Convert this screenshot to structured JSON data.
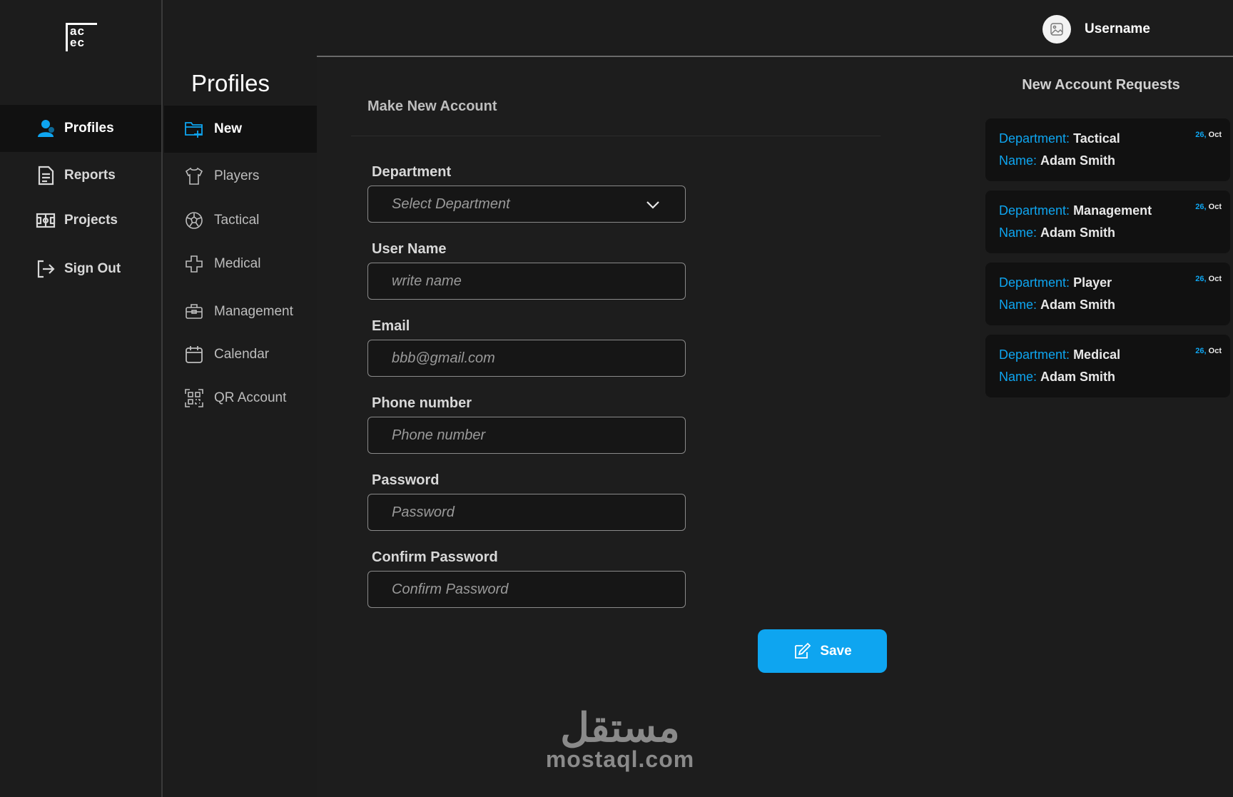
{
  "colors": {
    "accent": "#0ea5f0",
    "background": "#1b1b1b",
    "panel": "#111111"
  },
  "logo": {
    "line1": "ac",
    "line2": "ec"
  },
  "sidebar": {
    "items": [
      {
        "label": "Profiles",
        "icon": "user-icon"
      },
      {
        "label": "Reports",
        "icon": "document-icon"
      },
      {
        "label": "Projects",
        "icon": "field-icon"
      },
      {
        "label": "Sign Out",
        "icon": "sign-out-icon"
      }
    ]
  },
  "header": {
    "username": "Username",
    "avatar_icon": "image-icon"
  },
  "submenu": {
    "title": "Profiles",
    "items": [
      {
        "label": "New",
        "icon": "folder-plus-icon"
      },
      {
        "label": "Players",
        "icon": "shirt-icon"
      },
      {
        "label": "Tactical",
        "icon": "ball-icon"
      },
      {
        "label": "Medical",
        "icon": "medical-cross-icon"
      },
      {
        "label": "Management",
        "icon": "briefcase-icon"
      },
      {
        "label": "Calendar",
        "icon": "calendar-icon"
      },
      {
        "label": "QR Account",
        "icon": "qr-icon"
      }
    ]
  },
  "form": {
    "title": "Make New Account",
    "department": {
      "label": "Department",
      "placeholder": "Select Department"
    },
    "username": {
      "label": "User Name",
      "placeholder": "write name"
    },
    "email": {
      "label": "Email",
      "placeholder": "bbb@gmail.com"
    },
    "phone": {
      "label": "Phone number",
      "placeholder": "Phone number"
    },
    "password": {
      "label": "Password",
      "placeholder": "Password"
    },
    "confirm": {
      "label": "Confirm Password",
      "placeholder": "Confirm Password"
    },
    "save_label": "Save"
  },
  "watermark": {
    "arabic": "مستقل",
    "latin": "mostaql.com"
  },
  "requests": {
    "title": "New Account Requests",
    "dept_prefix": "Department:",
    "name_prefix": "Name:",
    "items": [
      {
        "department": "Tactical",
        "name": "Adam Smith",
        "day": "26,",
        "month": "Oct"
      },
      {
        "department": "Management",
        "name": "Adam Smith",
        "day": "26,",
        "month": "Oct"
      },
      {
        "department": "Player",
        "name": "Adam Smith",
        "day": "26,",
        "month": "Oct"
      },
      {
        "department": "Medical",
        "name": "Adam Smith",
        "day": "26,",
        "month": "Oct"
      }
    ]
  }
}
